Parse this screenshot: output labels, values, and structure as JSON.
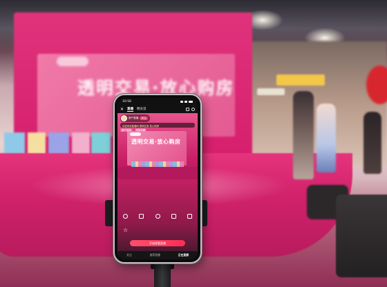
{
  "scene": {
    "backdrop_title": "透明交易·放心购房",
    "backdrop_subtitle": "",
    "colors": {
      "brand_pink": "#d61f6d",
      "cta_red": "#ff2e55"
    }
  },
  "phone": {
    "status": {
      "time": "10:56"
    },
    "topbar": {
      "close_icon": "close-icon",
      "tabs": [
        "直播",
        "明天见"
      ],
      "active_tab": "直播"
    },
    "video": {
      "host": {
        "name": "房产直播",
        "follow_label": "关注"
      },
      "notice": "欢迎来到直播间 透明交易 放心购房",
      "tags": [
        "房产直播",
        "选房攻略"
      ],
      "stage_title": "透明交易·放心购房"
    },
    "actions": [
      {
        "label": "",
        "icon": "share-icon"
      },
      {
        "label": "",
        "icon": "gift-icon"
      },
      {
        "label": "",
        "icon": "clock-icon"
      },
      {
        "label": "",
        "icon": "cart-icon"
      },
      {
        "label": "",
        "icon": "grid-icon"
      }
    ],
    "stats": [
      {
        "icon": "star-icon"
      },
      {
        "value": "",
        "label": ""
      },
      {
        "value": "",
        "label": ""
      },
      {
        "value": "",
        "label": ""
      }
    ],
    "cta_label": "开始观看直播",
    "bottom_nav": [
      "关注",
      "推荐直播",
      "正在直播"
    ],
    "bottom_nav_active": "正在直播"
  }
}
